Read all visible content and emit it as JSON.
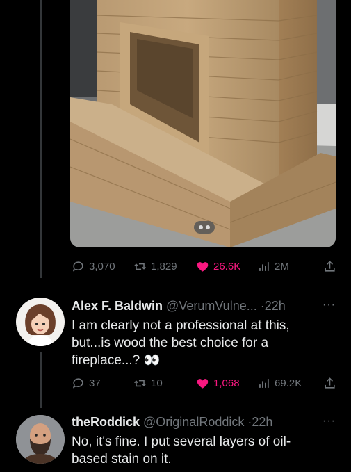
{
  "tweet": {
    "image_alt": "",
    "stats": {
      "replies": "3,070",
      "retweets": "1,829",
      "likes": "26.6K",
      "views": "2M"
    }
  },
  "replies": [
    {
      "display_name": "Alex F. Baldwin",
      "handle": "@VerumVulne...",
      "dot": "·",
      "time": "22h",
      "more": "···",
      "text": "I am clearly not a professional at this, but...is wood the best choice for a fireplace...?",
      "emoji": "👀",
      "stats": {
        "replies": "37",
        "retweets": "10",
        "likes": "1,068",
        "views": "69.2K"
      }
    },
    {
      "display_name": "theRoddick",
      "handle": "@OriginalRoddick",
      "dot": "·",
      "time": "22h",
      "more": "···",
      "text": "No, it's fine. I put several layers of oil-based stain on it."
    }
  ],
  "colors": {
    "accent_like": "#f91880",
    "muted": "#71767b",
    "text": "#e7e9ea",
    "background": "#000000"
  },
  "icons": [
    "reply-icon",
    "retweet-icon",
    "heart-icon",
    "views-icon",
    "share-icon",
    "more-icon"
  ]
}
